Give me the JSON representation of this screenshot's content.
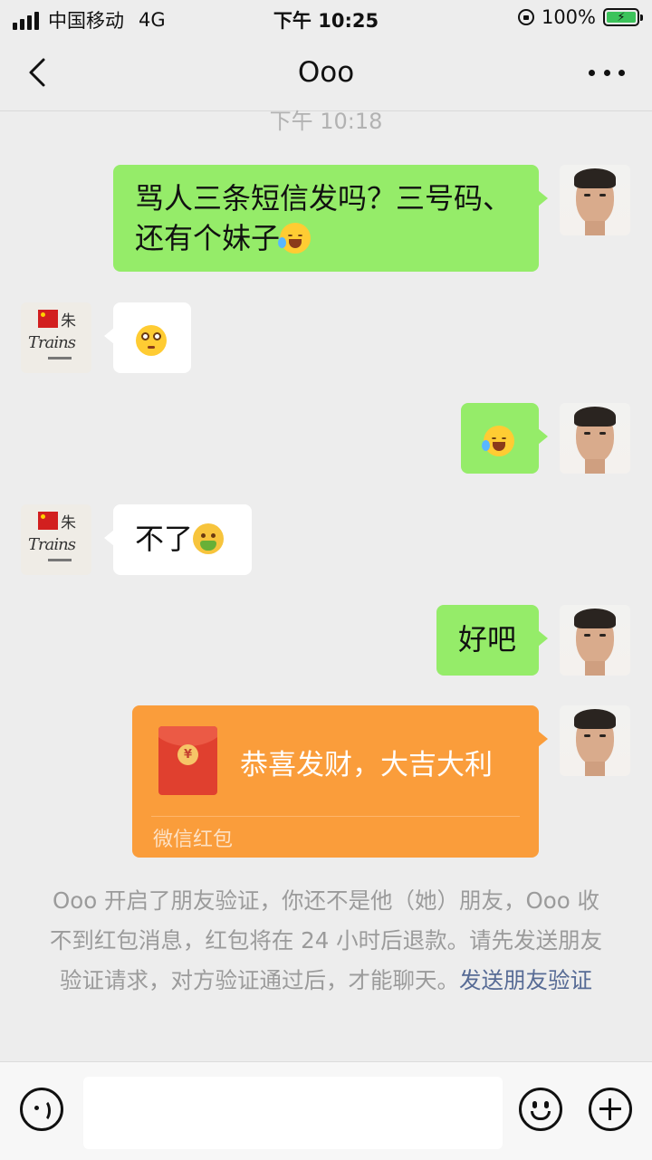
{
  "status_bar": {
    "carrier": "中国移动",
    "network": "4G",
    "time": "下午 10:25",
    "battery": "100%"
  },
  "nav": {
    "title": "Ooo"
  },
  "timestamp": "下午 10:18",
  "messages": [
    {
      "from": "me",
      "text": "骂人三条短信发吗？三号码、",
      "text2": "还有个妹子",
      "emoji": "laughing-crying"
    },
    {
      "from": "them",
      "emoji": "flushed"
    },
    {
      "from": "me",
      "emoji": "laughing-crying"
    },
    {
      "from": "them",
      "text": "不了",
      "emoji": "face-vomiting"
    },
    {
      "from": "me",
      "text": "好吧"
    },
    {
      "from": "me",
      "type": "red-packet",
      "text": "恭喜发财，大吉大利",
      "label": "微信红包"
    }
  ],
  "avatar_text": {
    "character": "朱",
    "script": "Trains"
  },
  "system_message": {
    "text": "Ooo 开启了朋友验证，你还不是他（她）朋友，Ooo 收不到红包消息，红包将在 24 小时后退款。请先发送朋友验证请求，对方验证通过后，才能聊天。",
    "link": "发送朋友验证"
  },
  "colors": {
    "bubble_me": "#95ec69",
    "bubble_them": "#ffffff",
    "red_packet": "#fa9d3b",
    "link": "#576b95"
  }
}
